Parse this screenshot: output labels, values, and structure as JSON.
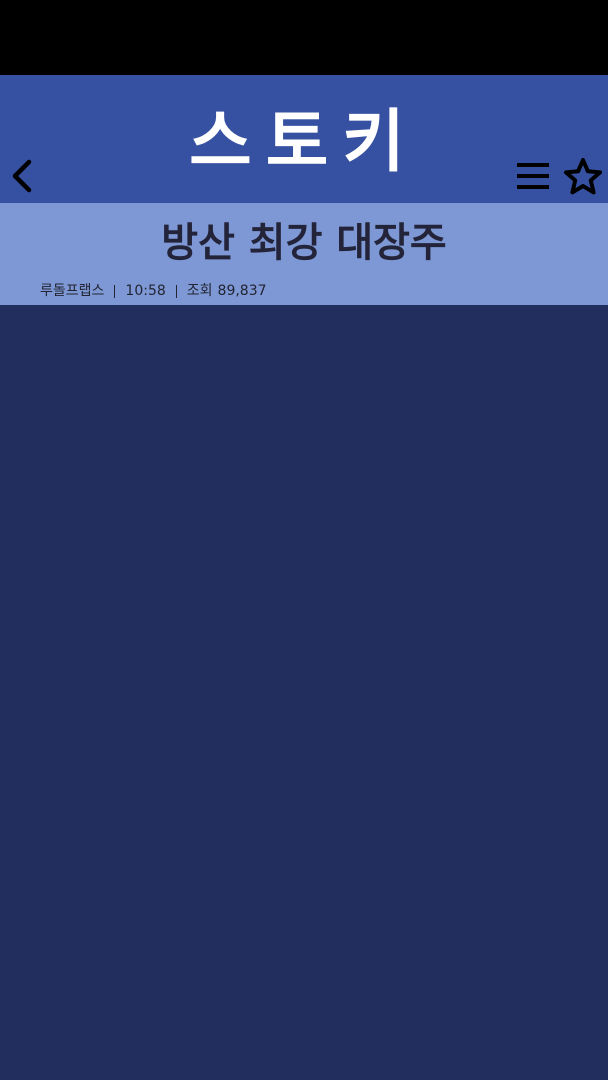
{
  "header": {
    "app_title": "스토키",
    "background_color": "#3651a2",
    "back_icon": "chevron-left-icon",
    "menu_icon": "hamburger-menu-icon",
    "star_icon": "star-outline-icon"
  },
  "article": {
    "title": "방산 최강 대장주",
    "author": "루돌프랩스",
    "time": "10:58",
    "views_label": "조회",
    "views_count": "89,837",
    "header_color": "#7d98d4"
  },
  "content": {
    "background_color": "#212e5e"
  }
}
